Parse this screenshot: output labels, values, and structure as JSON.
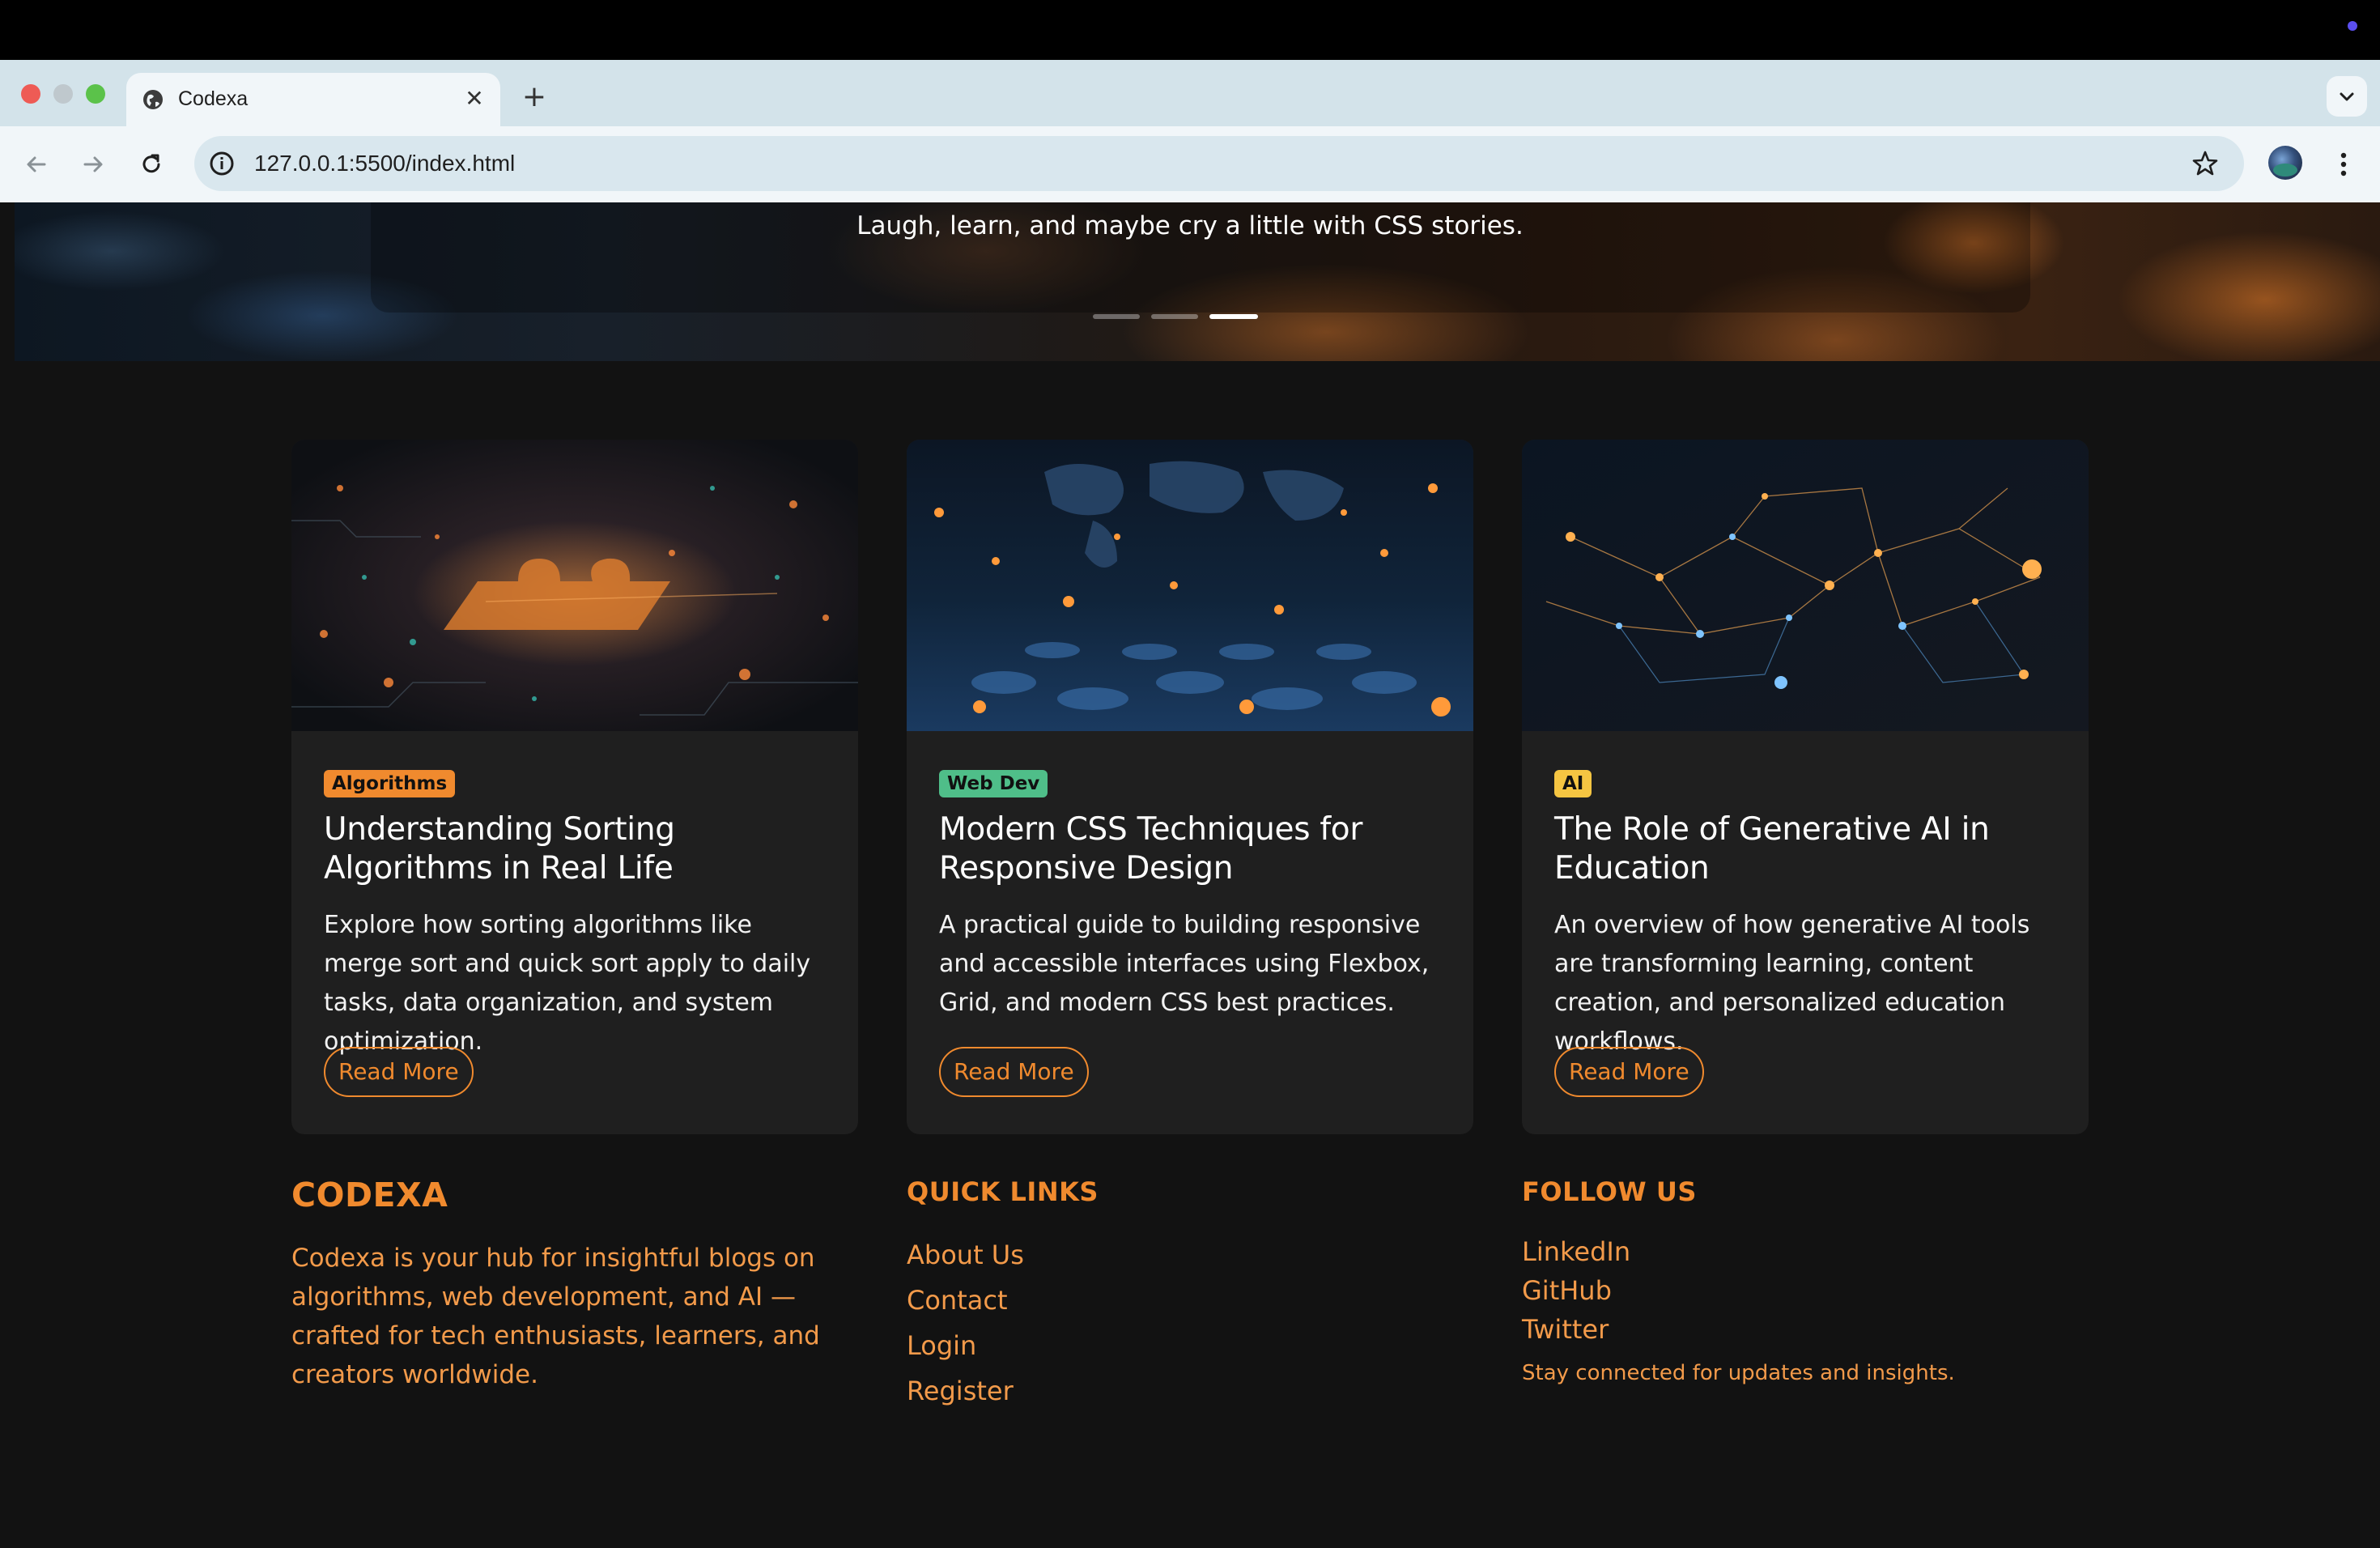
{
  "browser": {
    "tab_title": "Codexa",
    "url": "127.0.0.1:5500/index.html"
  },
  "hero": {
    "tagline": "Laugh, learn, and maybe cry a little with CSS stories.",
    "slides_total": 3,
    "active_slide": 3
  },
  "cards": [
    {
      "tag": "Algorithms",
      "tag_color": "#f08a2e",
      "title": "Understanding Sorting Algorithms in Real Life",
      "description": "Explore how sorting algorithms like merge sort and quick sort apply to daily tasks, data organization, and system optimization.",
      "button": "Read More"
    },
    {
      "tag": "Web Dev",
      "tag_color": "#4fbe89",
      "title": "Modern CSS Techniques for Responsive Design",
      "description": "A practical guide to building responsive and accessible interfaces using Flexbox, Grid, and modern CSS best practices.",
      "button": "Read More"
    },
    {
      "tag": "AI",
      "tag_color": "#f5c542",
      "title": "The Role of Generative AI in Education",
      "description": "An overview of how generative AI tools are transforming learning, content creation, and personalized education workflows.",
      "button": "Read More"
    }
  ],
  "footer": {
    "brand": "CODEXA",
    "brand_description": "Codexa is your hub for insightful blogs on algorithms, web development, and AI — crafted for tech enthusiasts, learners, and creators worldwide.",
    "quick_links_heading": "QUICK LINKS",
    "quick_links": [
      "About Us",
      "Contact",
      "Login",
      "Register"
    ],
    "follow_heading": "FOLLOW US",
    "social_links": [
      "LinkedIn",
      "GitHub",
      "Twitter"
    ],
    "follow_note": "Stay connected for updates and insights."
  },
  "colors": {
    "accent": "#f08a2e",
    "page_bg": "#121212",
    "card_bg": "#1f1f1f"
  }
}
